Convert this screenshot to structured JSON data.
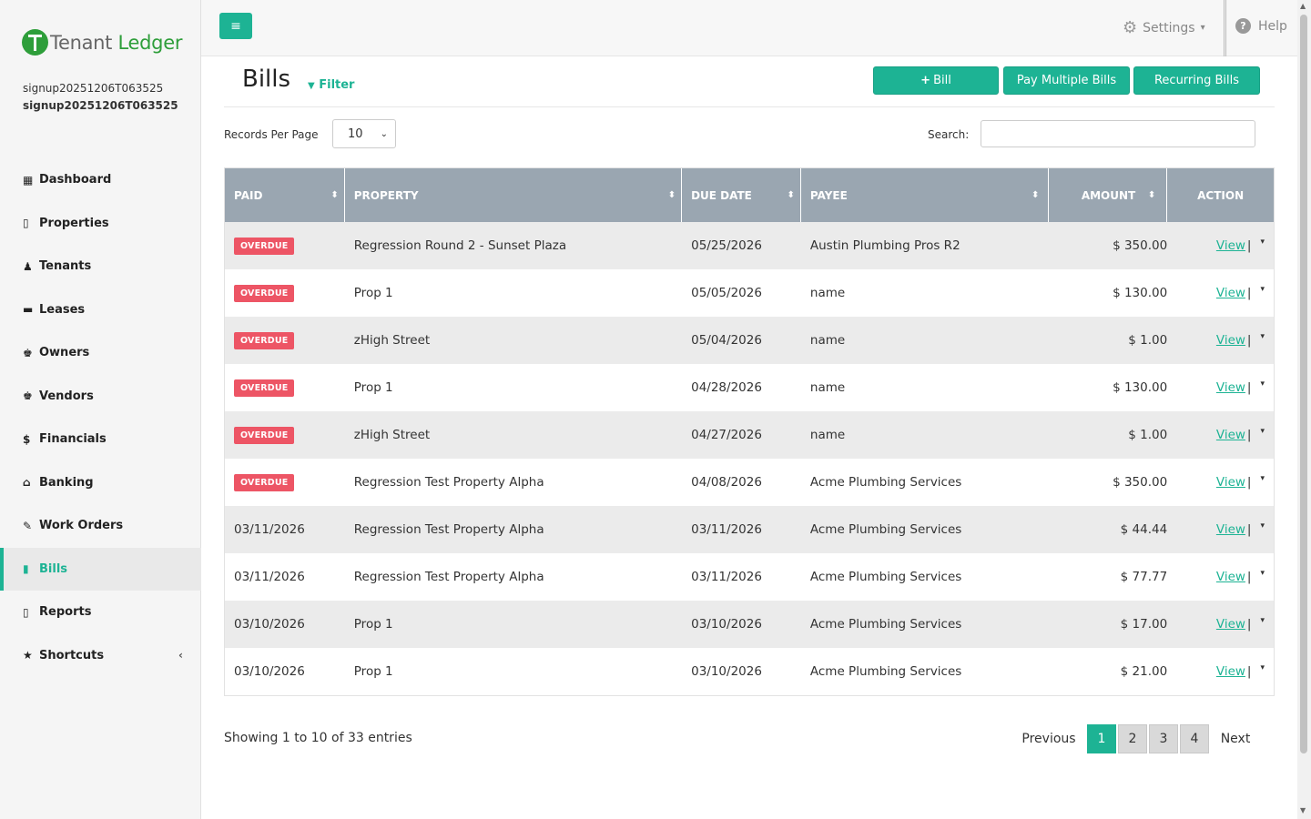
{
  "brand": {
    "name_part1": "Tenant",
    "name_part2": "Ledger"
  },
  "user": {
    "line1": "signup20251206T063525",
    "line2": "signup20251206T063525"
  },
  "nav": [
    {
      "label": "Dashboard",
      "icon": "▦",
      "name": "dashboard"
    },
    {
      "label": "Properties",
      "icon": "▯",
      "name": "properties"
    },
    {
      "label": "Tenants",
      "icon": "♟",
      "name": "tenants"
    },
    {
      "label": "Leases",
      "icon": "▬",
      "name": "leases"
    },
    {
      "label": "Owners",
      "icon": "♚",
      "name": "owners"
    },
    {
      "label": "Vendors",
      "icon": "♚",
      "name": "vendors"
    },
    {
      "label": "Financials",
      "icon": "$",
      "name": "financials"
    },
    {
      "label": "Banking",
      "icon": "⌂",
      "name": "banking"
    },
    {
      "label": "Work Orders",
      "icon": "✎",
      "name": "work-orders"
    },
    {
      "label": "Bills",
      "icon": "▮",
      "name": "bills",
      "active": true
    },
    {
      "label": "Reports",
      "icon": "▯",
      "name": "reports"
    },
    {
      "label": "Shortcuts",
      "icon": "★",
      "name": "shortcuts",
      "chevron": "‹"
    }
  ],
  "topbar": {
    "menu_icon": "≡",
    "settings_label": "Settings",
    "settings_caret": "▾",
    "help_label": "Help",
    "help_glyph": "?"
  },
  "page": {
    "title": "Bills",
    "filter_label": "Filter",
    "filter_icon": "▼",
    "buttons": {
      "add_bill": "Bill",
      "add_icon": "+",
      "pay_multiple": "Pay Multiple Bills",
      "recurring": "Recurring Bills"
    },
    "records_per_page_label": "Records Per Page",
    "records_per_page_value": "10",
    "search_label": "Search:",
    "search_value": ""
  },
  "table": {
    "headers": {
      "paid": "PAID",
      "property": "PROPERTY",
      "due_date": "DUE DATE",
      "payee": "PAYEE",
      "amount": "AMOUNT",
      "action": "ACTION"
    },
    "rows": [
      {
        "paid": "OVERDUE",
        "overdue": true,
        "property": "Regression Round 2 - Sunset Plaza",
        "due_date": "05/25/2026",
        "payee": "Austin Plumbing Pros R2",
        "amount": "$ 350.00"
      },
      {
        "paid": "OVERDUE",
        "overdue": true,
        "property": "Prop 1",
        "due_date": "05/05/2026",
        "payee": "name",
        "amount": "$ 130.00"
      },
      {
        "paid": "OVERDUE",
        "overdue": true,
        "property": "zHigh Street",
        "due_date": "05/04/2026",
        "payee": "name",
        "amount": "$ 1.00"
      },
      {
        "paid": "OVERDUE",
        "overdue": true,
        "property": "Prop 1",
        "due_date": "04/28/2026",
        "payee": "name",
        "amount": "$ 130.00"
      },
      {
        "paid": "OVERDUE",
        "overdue": true,
        "property": "zHigh Street",
        "due_date": "04/27/2026",
        "payee": "name",
        "amount": "$ 1.00"
      },
      {
        "paid": "OVERDUE",
        "overdue": true,
        "property": "Regression Test Property Alpha",
        "due_date": "04/08/2026",
        "payee": "Acme Plumbing Services",
        "amount": "$ 350.00"
      },
      {
        "paid": "03/11/2026",
        "overdue": false,
        "property": "Regression Test Property Alpha",
        "due_date": "03/11/2026",
        "payee": "Acme Plumbing Services",
        "amount": "$ 44.44"
      },
      {
        "paid": "03/11/2026",
        "overdue": false,
        "property": "Regression Test Property Alpha",
        "due_date": "03/11/2026",
        "payee": "Acme Plumbing Services",
        "amount": "$ 77.77"
      },
      {
        "paid": "03/10/2026",
        "overdue": false,
        "property": "Prop 1",
        "due_date": "03/10/2026",
        "payee": "Acme Plumbing Services",
        "amount": "$ 17.00"
      },
      {
        "paid": "03/10/2026",
        "overdue": false,
        "property": "Prop 1",
        "due_date": "03/10/2026",
        "payee": "Acme Plumbing Services",
        "amount": "$ 21.00"
      }
    ],
    "view_label": "View",
    "action_pipe": "|",
    "action_caret": "▾",
    "sort_glyph": "⬍"
  },
  "footer": {
    "showing": "Showing 1 to 10 of 33 entries",
    "previous": "Previous",
    "pages": [
      "1",
      "2",
      "3",
      "4"
    ],
    "active_page": "1",
    "next": "Next"
  },
  "colors": {
    "accent": "#1db394",
    "overdue": "#ed5565",
    "header_bg": "#9aa6b1",
    "brand_green": "#2e9e3a"
  }
}
